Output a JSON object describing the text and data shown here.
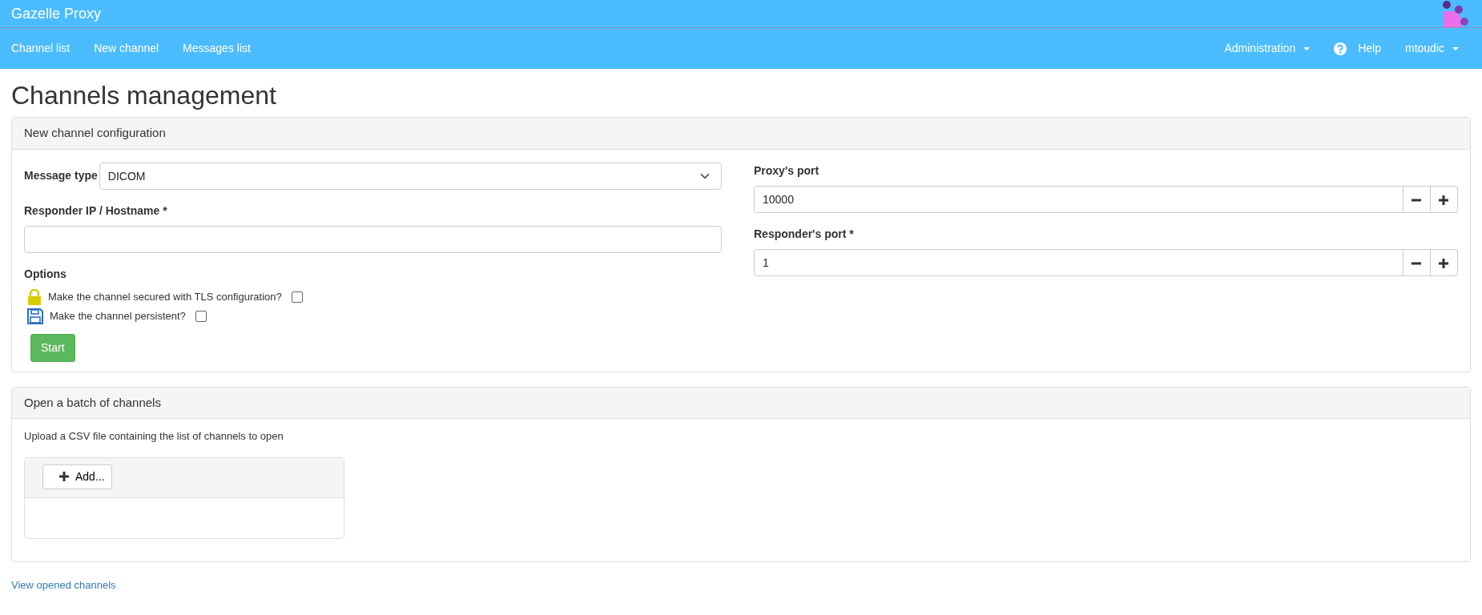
{
  "brand": "Gazelle Proxy",
  "nav_left": [
    {
      "label": "Channel list"
    },
    {
      "label": "New channel"
    },
    {
      "label": "Messages list"
    }
  ],
  "nav_right": [
    {
      "label": "Administration",
      "kind": "dropdown"
    },
    {
      "label": "Help",
      "kind": "help"
    },
    {
      "label": "mtoudic",
      "kind": "dropdown"
    }
  ],
  "page_title": "Channels management",
  "config_panel": {
    "title": "New channel configuration",
    "message_type": {
      "label": "Message type",
      "value": "DICOM"
    },
    "responder_host": {
      "label": "Responder IP / Hostname *"
    },
    "options_label": "Options",
    "options": [
      {
        "kind": "lock",
        "label": "Make the channel secured with TLS configuration?",
        "checked": false
      },
      {
        "kind": "floppy",
        "label": "Make the channel persistent?",
        "checked": false
      }
    ],
    "start_button": "Start",
    "ports": [
      {
        "label": "Proxy's port",
        "value": "10000"
      },
      {
        "label": "Responder's port *",
        "value": "1"
      }
    ]
  },
  "batch_panel": {
    "title": "Open a batch of channels",
    "description": "Upload a CSV file containing the list of channels to open",
    "add_button": "Add..."
  },
  "footer_link": "View opened channels"
}
